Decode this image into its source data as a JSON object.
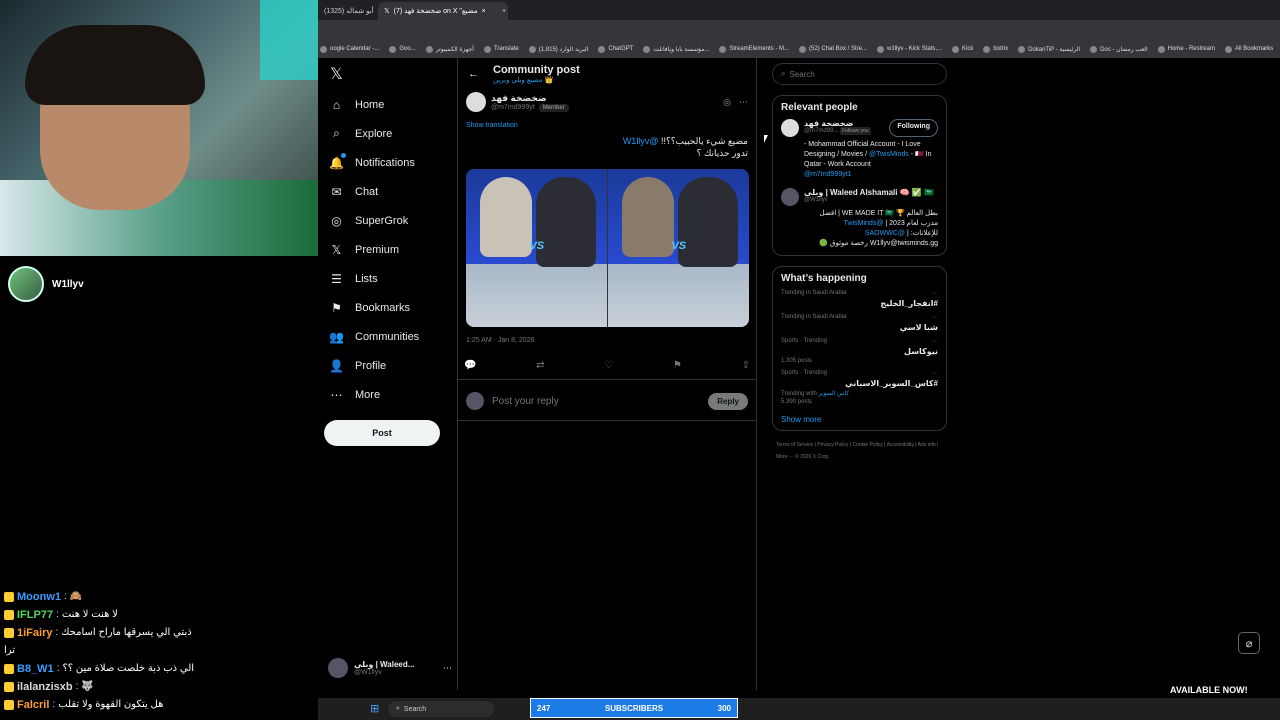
{
  "stream": {
    "streamer_name": "W1llyv",
    "chat": [
      {
        "user": "Moonw1",
        "msg": "🙈",
        "color": "#3b9bff"
      },
      {
        "user": "IFLP77",
        "msg": "لا هنت لا هنت",
        "color": "#4fd65c"
      },
      {
        "user": "1iFairy",
        "msg": "ذبتي الي يسرقها ماراح اسامحك",
        "color": "#ff9f2e"
      },
      {
        "user": "",
        "msg": "ترا",
        "color": "#ffffff"
      },
      {
        "user": "B8_W1",
        "msg": "الي ذب ذبة خلصت صلاة مين ؟؟",
        "color": "#3b9bff"
      },
      {
        "user": "ilalanzisxb",
        "msg": "🐺",
        "color": "#d9d9d9"
      },
      {
        "user": "Falcril",
        "msg": "هل يتكون القهوة ولا تقلب",
        "color": "#ff9f2e"
      }
    ],
    "subscribers_count": "247",
    "subscribers_label": "SUBSCRIBERS",
    "subscribers_goal": "300",
    "available_text": "AVAILABLE NOW!"
  },
  "browser": {
    "tabs": [
      {
        "label": "أبو شماله (1325)"
      },
      {
        "label": "(7) ضخضخة فهد on X \"مضيع"
      }
    ],
    "bookmarks": [
      "oogle Calendar -...",
      "Goo...",
      "أجهزة الكمبيوتر",
      "Translate",
      "البريد الوارد (1,815)",
      "ChatGPT",
      "مؤسسة بابا ويافانلت...",
      "StreamElements - M...",
      "(52) Chat Box / Stre...",
      "w1llyv - Kick Stats,...",
      "Kick",
      "botrix",
      "DokanTiP - الرئيسية",
      "Doc - العب رمضان",
      "Home - Restream",
      "All Bookmarks"
    ]
  },
  "nav": {
    "items": [
      {
        "label": "Home",
        "icon": "home-icon",
        "glyph": "⌂"
      },
      {
        "label": "Explore",
        "icon": "search-icon",
        "glyph": "⌕"
      },
      {
        "label": "Notifications",
        "icon": "bell-icon",
        "glyph": "🔔"
      },
      {
        "label": "Chat",
        "icon": "chat-icon",
        "glyph": "✉"
      },
      {
        "label": "SuperGrok",
        "icon": "grok-icon",
        "glyph": "◎"
      },
      {
        "label": "Premium",
        "icon": "x-logo-icon",
        "glyph": "𝕏"
      },
      {
        "label": "Lists",
        "icon": "list-icon",
        "glyph": "☰"
      },
      {
        "label": "Bookmarks",
        "icon": "bookmark-icon",
        "glyph": "⚑"
      },
      {
        "label": "Communities",
        "icon": "communities-icon",
        "glyph": "👥"
      },
      {
        "label": "Profile",
        "icon": "profile-icon",
        "glyph": "👤"
      },
      {
        "label": "More",
        "icon": "more-icon",
        "glyph": "⋯"
      }
    ],
    "post_label": "Post",
    "account_name": "وبلي | Waleed...",
    "account_handle": "@W1llyv"
  },
  "main": {
    "header_title": "Community post",
    "header_subtitle": "مضيع وبلي وبرين 👑",
    "author_name": "ضخضخة فهد",
    "author_handle": "@m7md999yt",
    "member_badge": "Member",
    "show_translation": "Show translation",
    "mention": "@W1llyv",
    "text_line1": "مضيع شيء يالحبيب؟؟!!",
    "text_line2": "تدور حذيانك ؟",
    "timestamp": "1:25 AM · Jan 8, 2026",
    "reply_placeholder": "Post your reply",
    "reply_button": "Reply"
  },
  "right": {
    "search_placeholder": "Search",
    "relevant_title": "Relevant people",
    "people": [
      {
        "name": "ضخضخة فهد",
        "handle": "@m7md99...",
        "follows_you": "Follows you",
        "button": "Following",
        "bio": "- Mohammad Official Account - I Love Designing / Movies / ",
        "bio_link": "@TwisMinds",
        "bio_tail": " - 🇶🇦 In Qatar - Work Account",
        "bio_link2": "@m7md999yt1"
      },
      {
        "name": "وبلي | Waleed Alshamali 🧠 ✅ 🇸🇦",
        "handle": "@W1llyv",
        "bio_lines": [
          "بطل العالم 🏆 WE MADE IT 🇸🇦 | افضل",
          "مدرب لعام 2023 | ",
          "@TwisMinds",
          "للإعلانات: | ",
          "@SAOWWC",
          "W1llyv@twisminds.gg رخصة موثوق 🟢"
        ]
      }
    ],
    "happening_title": "What’s happening",
    "trends": [
      {
        "meta": "Trending in Saudi Arabia",
        "name": "#انفجار_الخليج",
        "count": ""
      },
      {
        "meta": "Trending in Saudi Arabia",
        "name": "شبا لاسي",
        "count": ""
      },
      {
        "meta": "Sports · Trending",
        "name": "نيوكاسل",
        "count": "1,305 posts"
      },
      {
        "meta": "Sports · Trending",
        "name": "#كاس_السوبر_الاسباني",
        "count": "5,390 posts",
        "with": "Trending with ",
        "with_link": "كاس السوبر"
      }
    ],
    "show_more": "Show more",
    "footer": "Terms of Service | Privacy Policy | Cookie Policy | Accessibility | Ads info | More ··· © 2026 X Corp."
  },
  "taskbar": {
    "search_placeholder": "Search"
  },
  "colors": {
    "accent": "#1d9bf0",
    "background": "#000000",
    "border": "#2f3336",
    "sub_bar": "#1d7be8"
  }
}
